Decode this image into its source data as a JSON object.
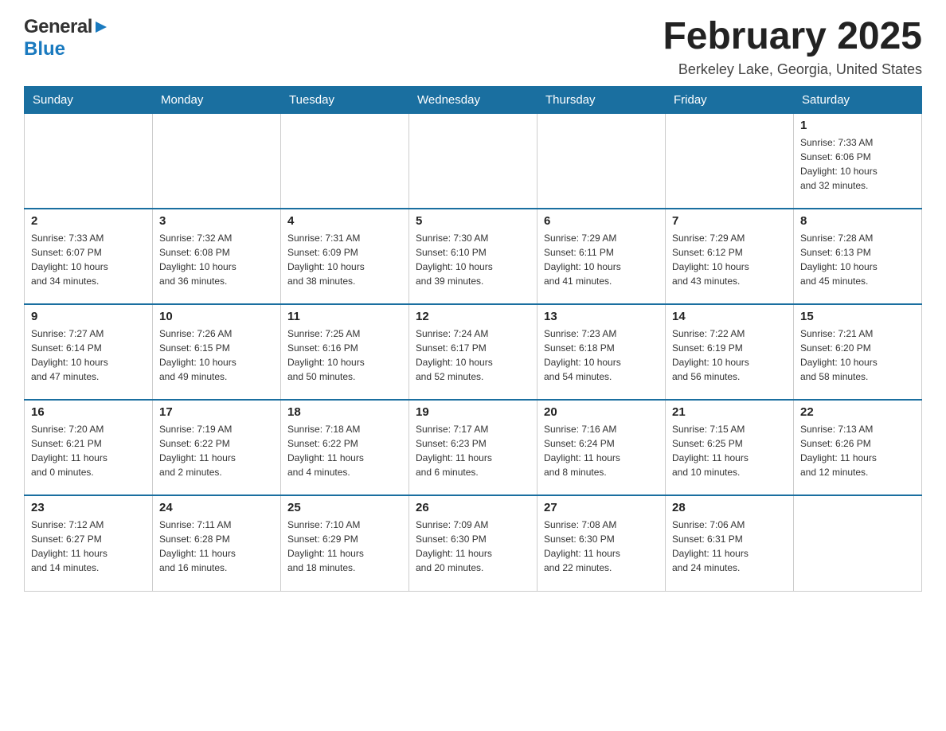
{
  "header": {
    "logo_general": "General",
    "logo_blue": "Blue",
    "month_title": "February 2025",
    "location": "Berkeley Lake, Georgia, United States"
  },
  "weekdays": [
    "Sunday",
    "Monday",
    "Tuesday",
    "Wednesday",
    "Thursday",
    "Friday",
    "Saturday"
  ],
  "weeks": [
    {
      "days": [
        {
          "number": "",
          "info": ""
        },
        {
          "number": "",
          "info": ""
        },
        {
          "number": "",
          "info": ""
        },
        {
          "number": "",
          "info": ""
        },
        {
          "number": "",
          "info": ""
        },
        {
          "number": "",
          "info": ""
        },
        {
          "number": "1",
          "info": "Sunrise: 7:33 AM\nSunset: 6:06 PM\nDaylight: 10 hours\nand 32 minutes."
        }
      ]
    },
    {
      "days": [
        {
          "number": "2",
          "info": "Sunrise: 7:33 AM\nSunset: 6:07 PM\nDaylight: 10 hours\nand 34 minutes."
        },
        {
          "number": "3",
          "info": "Sunrise: 7:32 AM\nSunset: 6:08 PM\nDaylight: 10 hours\nand 36 minutes."
        },
        {
          "number": "4",
          "info": "Sunrise: 7:31 AM\nSunset: 6:09 PM\nDaylight: 10 hours\nand 38 minutes."
        },
        {
          "number": "5",
          "info": "Sunrise: 7:30 AM\nSunset: 6:10 PM\nDaylight: 10 hours\nand 39 minutes."
        },
        {
          "number": "6",
          "info": "Sunrise: 7:29 AM\nSunset: 6:11 PM\nDaylight: 10 hours\nand 41 minutes."
        },
        {
          "number": "7",
          "info": "Sunrise: 7:29 AM\nSunset: 6:12 PM\nDaylight: 10 hours\nand 43 minutes."
        },
        {
          "number": "8",
          "info": "Sunrise: 7:28 AM\nSunset: 6:13 PM\nDaylight: 10 hours\nand 45 minutes."
        }
      ]
    },
    {
      "days": [
        {
          "number": "9",
          "info": "Sunrise: 7:27 AM\nSunset: 6:14 PM\nDaylight: 10 hours\nand 47 minutes."
        },
        {
          "number": "10",
          "info": "Sunrise: 7:26 AM\nSunset: 6:15 PM\nDaylight: 10 hours\nand 49 minutes."
        },
        {
          "number": "11",
          "info": "Sunrise: 7:25 AM\nSunset: 6:16 PM\nDaylight: 10 hours\nand 50 minutes."
        },
        {
          "number": "12",
          "info": "Sunrise: 7:24 AM\nSunset: 6:17 PM\nDaylight: 10 hours\nand 52 minutes."
        },
        {
          "number": "13",
          "info": "Sunrise: 7:23 AM\nSunset: 6:18 PM\nDaylight: 10 hours\nand 54 minutes."
        },
        {
          "number": "14",
          "info": "Sunrise: 7:22 AM\nSunset: 6:19 PM\nDaylight: 10 hours\nand 56 minutes."
        },
        {
          "number": "15",
          "info": "Sunrise: 7:21 AM\nSunset: 6:20 PM\nDaylight: 10 hours\nand 58 minutes."
        }
      ]
    },
    {
      "days": [
        {
          "number": "16",
          "info": "Sunrise: 7:20 AM\nSunset: 6:21 PM\nDaylight: 11 hours\nand 0 minutes."
        },
        {
          "number": "17",
          "info": "Sunrise: 7:19 AM\nSunset: 6:22 PM\nDaylight: 11 hours\nand 2 minutes."
        },
        {
          "number": "18",
          "info": "Sunrise: 7:18 AM\nSunset: 6:22 PM\nDaylight: 11 hours\nand 4 minutes."
        },
        {
          "number": "19",
          "info": "Sunrise: 7:17 AM\nSunset: 6:23 PM\nDaylight: 11 hours\nand 6 minutes."
        },
        {
          "number": "20",
          "info": "Sunrise: 7:16 AM\nSunset: 6:24 PM\nDaylight: 11 hours\nand 8 minutes."
        },
        {
          "number": "21",
          "info": "Sunrise: 7:15 AM\nSunset: 6:25 PM\nDaylight: 11 hours\nand 10 minutes."
        },
        {
          "number": "22",
          "info": "Sunrise: 7:13 AM\nSunset: 6:26 PM\nDaylight: 11 hours\nand 12 minutes."
        }
      ]
    },
    {
      "days": [
        {
          "number": "23",
          "info": "Sunrise: 7:12 AM\nSunset: 6:27 PM\nDaylight: 11 hours\nand 14 minutes."
        },
        {
          "number": "24",
          "info": "Sunrise: 7:11 AM\nSunset: 6:28 PM\nDaylight: 11 hours\nand 16 minutes."
        },
        {
          "number": "25",
          "info": "Sunrise: 7:10 AM\nSunset: 6:29 PM\nDaylight: 11 hours\nand 18 minutes."
        },
        {
          "number": "26",
          "info": "Sunrise: 7:09 AM\nSunset: 6:30 PM\nDaylight: 11 hours\nand 20 minutes."
        },
        {
          "number": "27",
          "info": "Sunrise: 7:08 AM\nSunset: 6:30 PM\nDaylight: 11 hours\nand 22 minutes."
        },
        {
          "number": "28",
          "info": "Sunrise: 7:06 AM\nSunset: 6:31 PM\nDaylight: 11 hours\nand 24 minutes."
        },
        {
          "number": "",
          "info": ""
        }
      ]
    }
  ]
}
